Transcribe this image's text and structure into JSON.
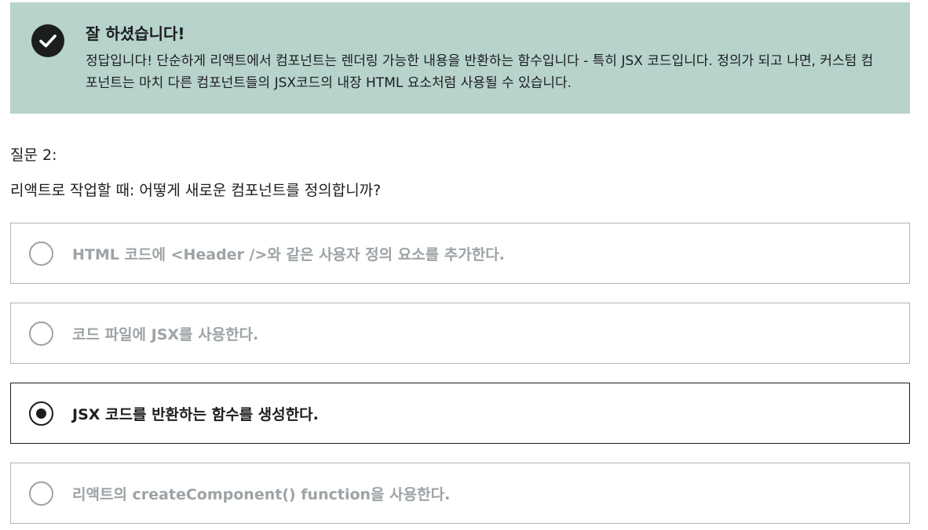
{
  "feedback": {
    "icon": "check-circle-icon",
    "title": "잘 하셨습니다!",
    "body": "정답입니다! 단순하게 리액트에서 컴포넌트는 렌더링 가능한 내용을 반환하는 함수입니다 - 특히 JSX 코드입니다. 정의가 되고 나면, 커스텀 컴포넌트는 마치 다른 컴포넌트들의 JSX코드의 내장 HTML 요소처럼 사용될 수 있습니다.",
    "background_color": "#b7d3cc"
  },
  "question": {
    "number_label": "질문 2:",
    "text": "리액트로 작업할 때: 어떻게 새로운 컴포넌트를 정의합니까?"
  },
  "options": [
    {
      "label": "HTML 코드에 <Header />와 같은 사용자 정의 요소를 추가한다.",
      "selected": false
    },
    {
      "label": "코드 파일에 JSX를 사용한다.",
      "selected": false
    },
    {
      "label": "JSX 코드를 반환하는 함수를 생성한다.",
      "selected": true
    },
    {
      "label": "리액트의 createComponent() function을 사용한다.",
      "selected": false
    }
  ]
}
